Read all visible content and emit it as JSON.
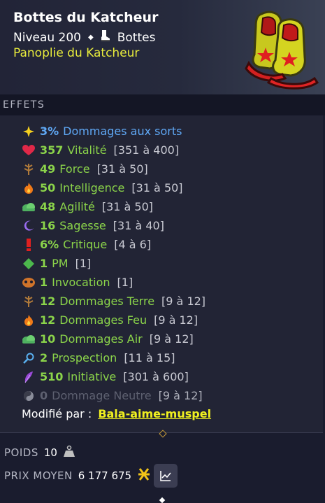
{
  "item": {
    "name": "Bottes du Katcheur",
    "level": "Niveau 200",
    "type": "Bottes",
    "set": "Panoplie du Katcheur"
  },
  "effects_title": "EFFETS",
  "effects": [
    {
      "icon": "sparkle-icon",
      "amount": "3%",
      "name": "Dommages aux sorts",
      "range": "",
      "color": "#5fa8f5"
    },
    {
      "icon": "heart-icon",
      "amount": "357",
      "name": "Vitalité",
      "range": "[351 à 400]",
      "color": "#8bd44a"
    },
    {
      "icon": "earth-icon",
      "amount": "49",
      "name": "Force",
      "range": "[31 à 50]",
      "color": "#8bd44a"
    },
    {
      "icon": "fire-icon",
      "amount": "50",
      "name": "Intelligence",
      "range": "[31 à 50]",
      "color": "#8bd44a"
    },
    {
      "icon": "air-icon",
      "amount": "48",
      "name": "Agilité",
      "range": "[31 à 50]",
      "color": "#8bd44a"
    },
    {
      "icon": "moon-icon",
      "amount": "16",
      "name": "Sagesse",
      "range": "[31 à 40]",
      "color": "#8bd44a"
    },
    {
      "icon": "exclamation-icon",
      "amount": "6%",
      "name": "Critique",
      "range": "[4 à 6]",
      "color": "#8bd44a"
    },
    {
      "icon": "diamond-icon",
      "amount": "1",
      "name": "PM",
      "range": "[1]",
      "color": "#8bd44a"
    },
    {
      "icon": "invocation-icon",
      "amount": "1",
      "name": "Invocation",
      "range": "[1]",
      "color": "#8bd44a"
    },
    {
      "icon": "earth-icon",
      "amount": "12",
      "name": "Dommages Terre",
      "range": "[9 à 12]",
      "color": "#8bd44a"
    },
    {
      "icon": "fire-icon",
      "amount": "12",
      "name": "Dommages Feu",
      "range": "[9 à 12]",
      "color": "#8bd44a"
    },
    {
      "icon": "air-icon",
      "amount": "10",
      "name": "Dommages Air",
      "range": "[9 à 12]",
      "color": "#8bd44a"
    },
    {
      "icon": "magnifier-icon",
      "amount": "2",
      "name": "Prospection",
      "range": "[11 à 15]",
      "color": "#8bd44a"
    },
    {
      "icon": "feather-icon",
      "amount": "510",
      "name": "Initiative",
      "range": "[301 à 600]",
      "color": "#8bd44a"
    },
    {
      "icon": "neutral-icon",
      "amount": "0",
      "name": "Dommage Neutre",
      "range": "[9 à 12]",
      "color": "#5d6070"
    }
  ],
  "modified": {
    "label": "Modifié par :",
    "by": "Bala-aime-muspel"
  },
  "weight": {
    "label": "POIDS",
    "value": "10"
  },
  "price": {
    "label": "PRIX MOYEN",
    "value": "6 177 675"
  },
  "colors": {
    "accent_yellow": "#e8ec3c",
    "stat_green": "#8bd44a",
    "stat_blue": "#5fa8f5",
    "disabled_grey": "#5d6070"
  }
}
